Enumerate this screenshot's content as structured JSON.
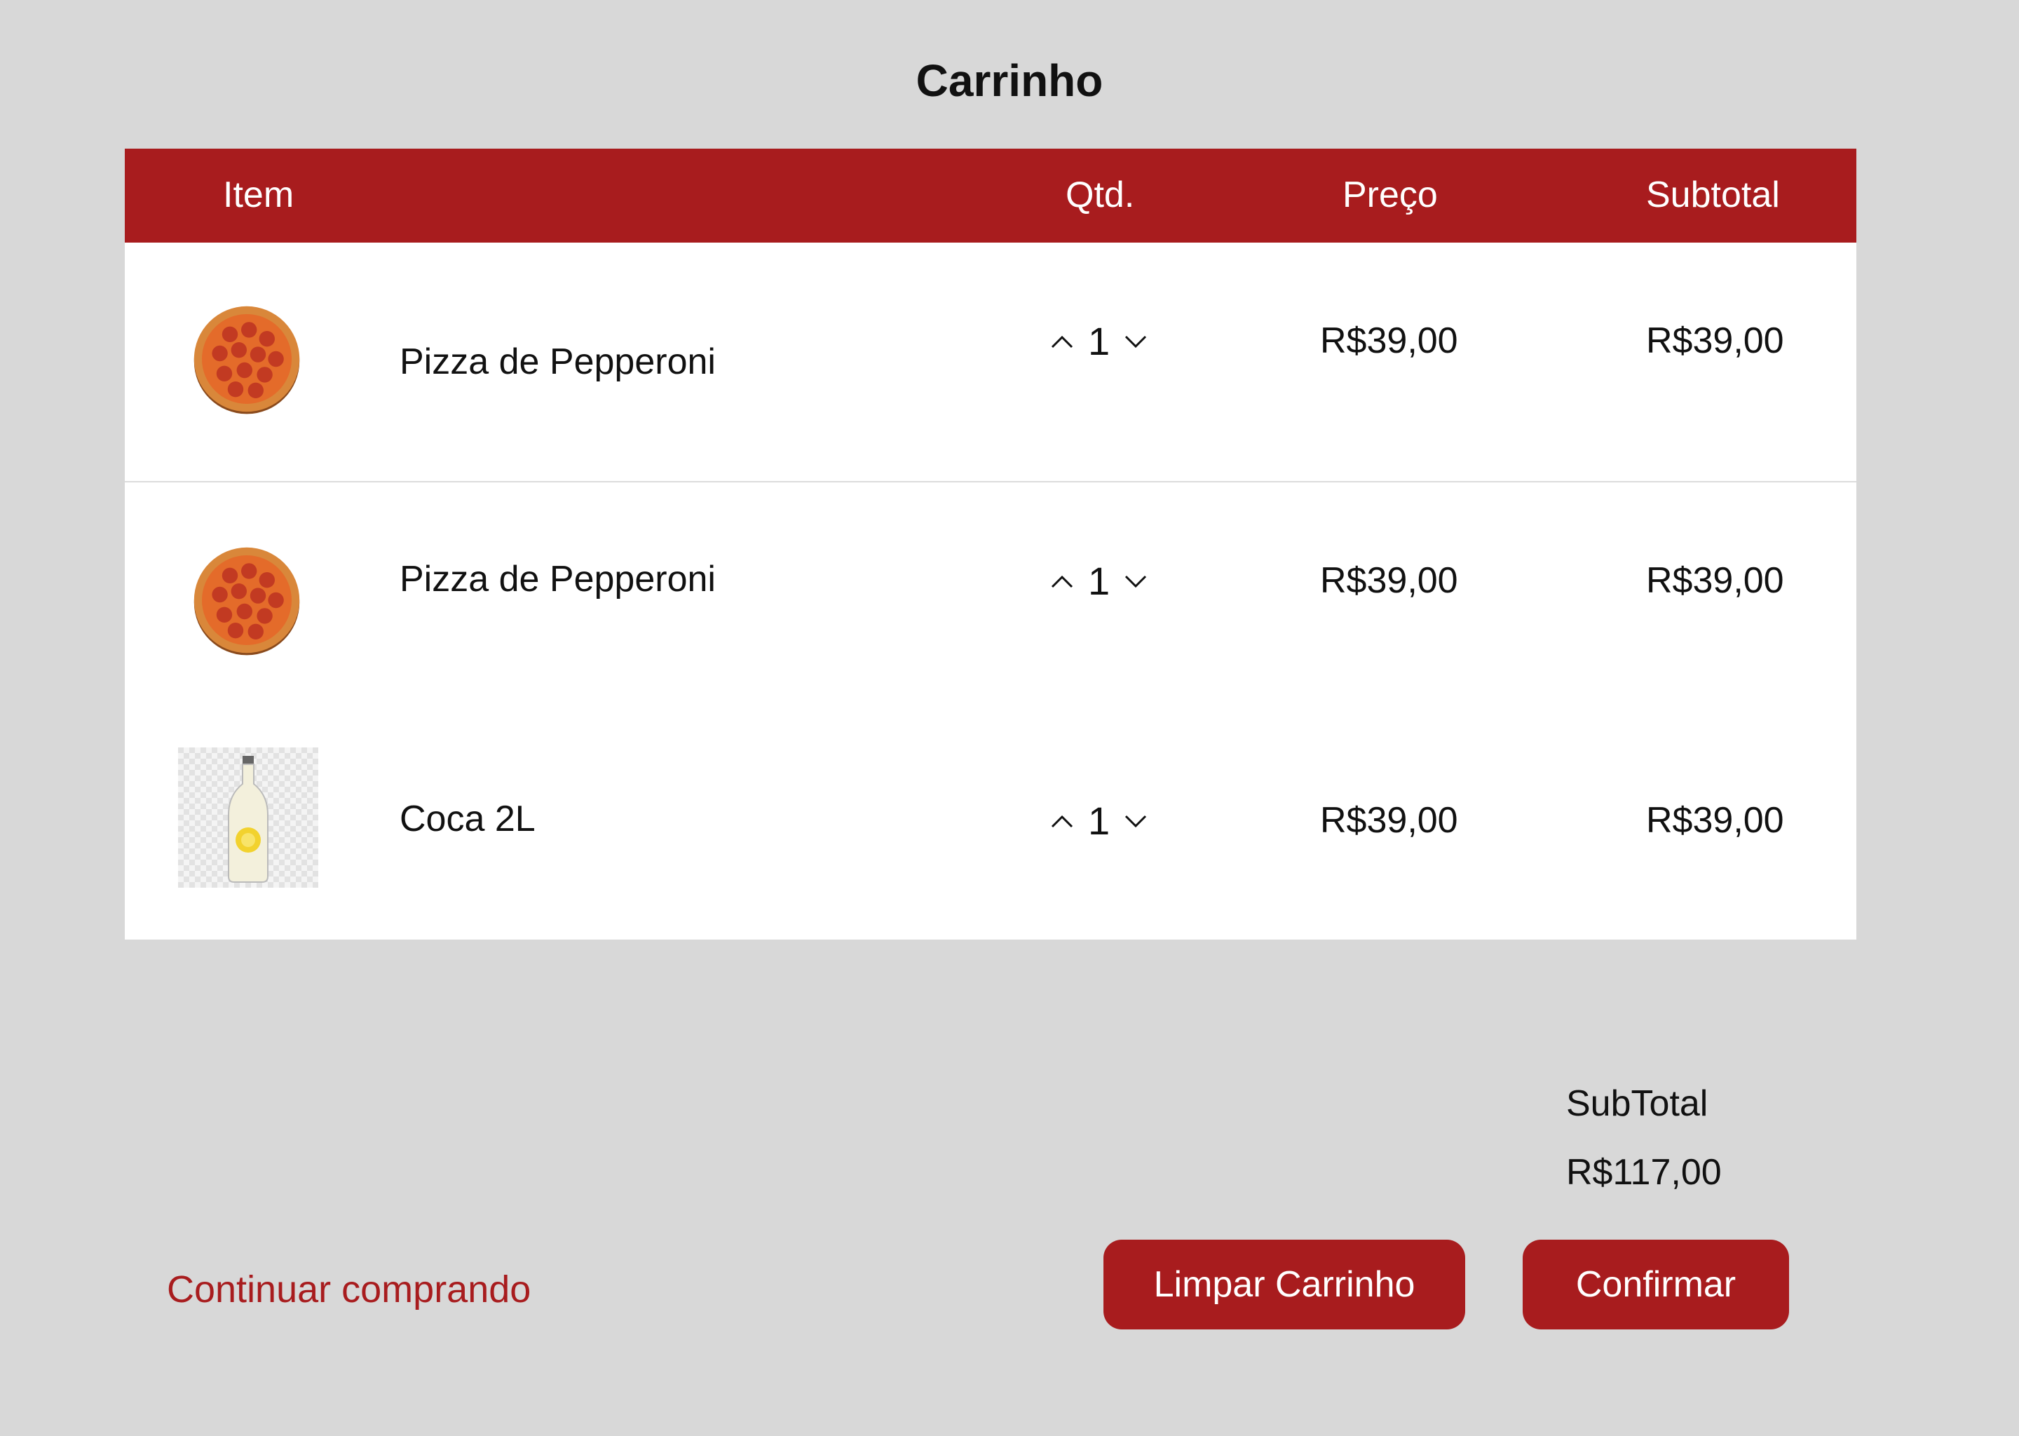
{
  "page": {
    "title": "Carrinho"
  },
  "table": {
    "headers": {
      "item": "Item",
      "qtd": "Qtd.",
      "preco": "Preço",
      "subtotal": "Subtotal"
    },
    "rows": [
      {
        "name": "Pizza de Pepperoni",
        "qty": "1",
        "price": "R$39,00",
        "subtotal": "R$39,00",
        "icon": "pizza-icon"
      },
      {
        "name": "Pizza de Pepperoni",
        "qty": "1",
        "price": "R$39,00",
        "subtotal": "R$39,00",
        "icon": "pizza-icon"
      },
      {
        "name": "Coca 2L",
        "qty": "1",
        "price": "R$39,00",
        "subtotal": "R$39,00",
        "icon": "bottle-icon"
      }
    ]
  },
  "summary": {
    "label": "SubTotal",
    "value": "R$117,00"
  },
  "actions": {
    "continue_label": "Continuar comprando",
    "clear_label": "Limpar Carrinho",
    "confirm_label": "Confirmar"
  },
  "colors": {
    "brand": "#a81c1e",
    "background": "#d8d8d8"
  }
}
